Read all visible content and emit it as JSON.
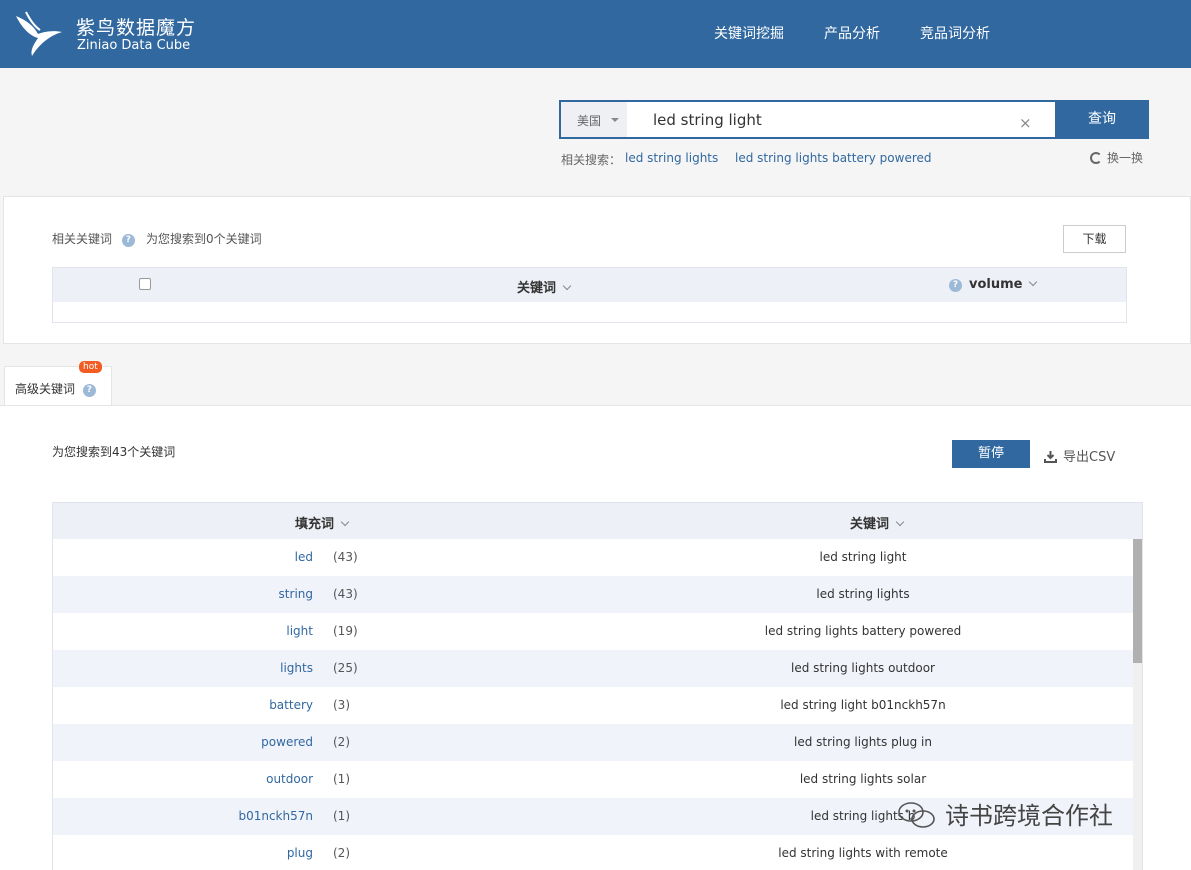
{
  "brand": {
    "name_cn": "紫鸟数据魔方",
    "name_en": "Ziniao Data Cube"
  },
  "nav": [
    "关键词挖掘",
    "产品分析",
    "竞品词分析"
  ],
  "search": {
    "country": "美国",
    "value": "led string light",
    "clear": "×",
    "button": "查询"
  },
  "related": {
    "label": "相关搜索：",
    "items": [
      "led string lights",
      "led string lights battery powered"
    ],
    "refresh": "换一换"
  },
  "related_keywords": {
    "title": "相关关键词",
    "question": "?",
    "count_text": "为您搜索到0个关键词",
    "download": "下载",
    "col_keyword": "关键词",
    "col_volume": "volume"
  },
  "advanced": {
    "tab": "高级关键词",
    "hot": "hot",
    "count_text": "为您搜索到43个关键词",
    "pause": "暂停",
    "export": "导出CSV",
    "col_fill": "填充词",
    "col_keyword": "关键词",
    "rows": [
      {
        "word": "led",
        "count": "(43)",
        "keyword": "led string light"
      },
      {
        "word": "string",
        "count": "(43)",
        "keyword": "led string lights"
      },
      {
        "word": "light",
        "count": "(19)",
        "keyword": "led string lights battery powered"
      },
      {
        "word": "lights",
        "count": "(25)",
        "keyword": "led string lights outdoor"
      },
      {
        "word": "battery",
        "count": "(3)",
        "keyword": "led string light b01nckh57n"
      },
      {
        "word": "powered",
        "count": "(2)",
        "keyword": "led string lights plug in"
      },
      {
        "word": "outdoor",
        "count": "(1)",
        "keyword": "led string lights solar"
      },
      {
        "word": "b01nckh57n",
        "count": "(1)",
        "keyword": "led string lights b"
      },
      {
        "word": "plug",
        "count": "(2)",
        "keyword": "led string lights with remote"
      }
    ]
  },
  "watermark": "诗书跨境合作社",
  "colors": {
    "primary": "#3168a0",
    "hot": "#f25c22",
    "row_alt": "#f1f3fa"
  }
}
